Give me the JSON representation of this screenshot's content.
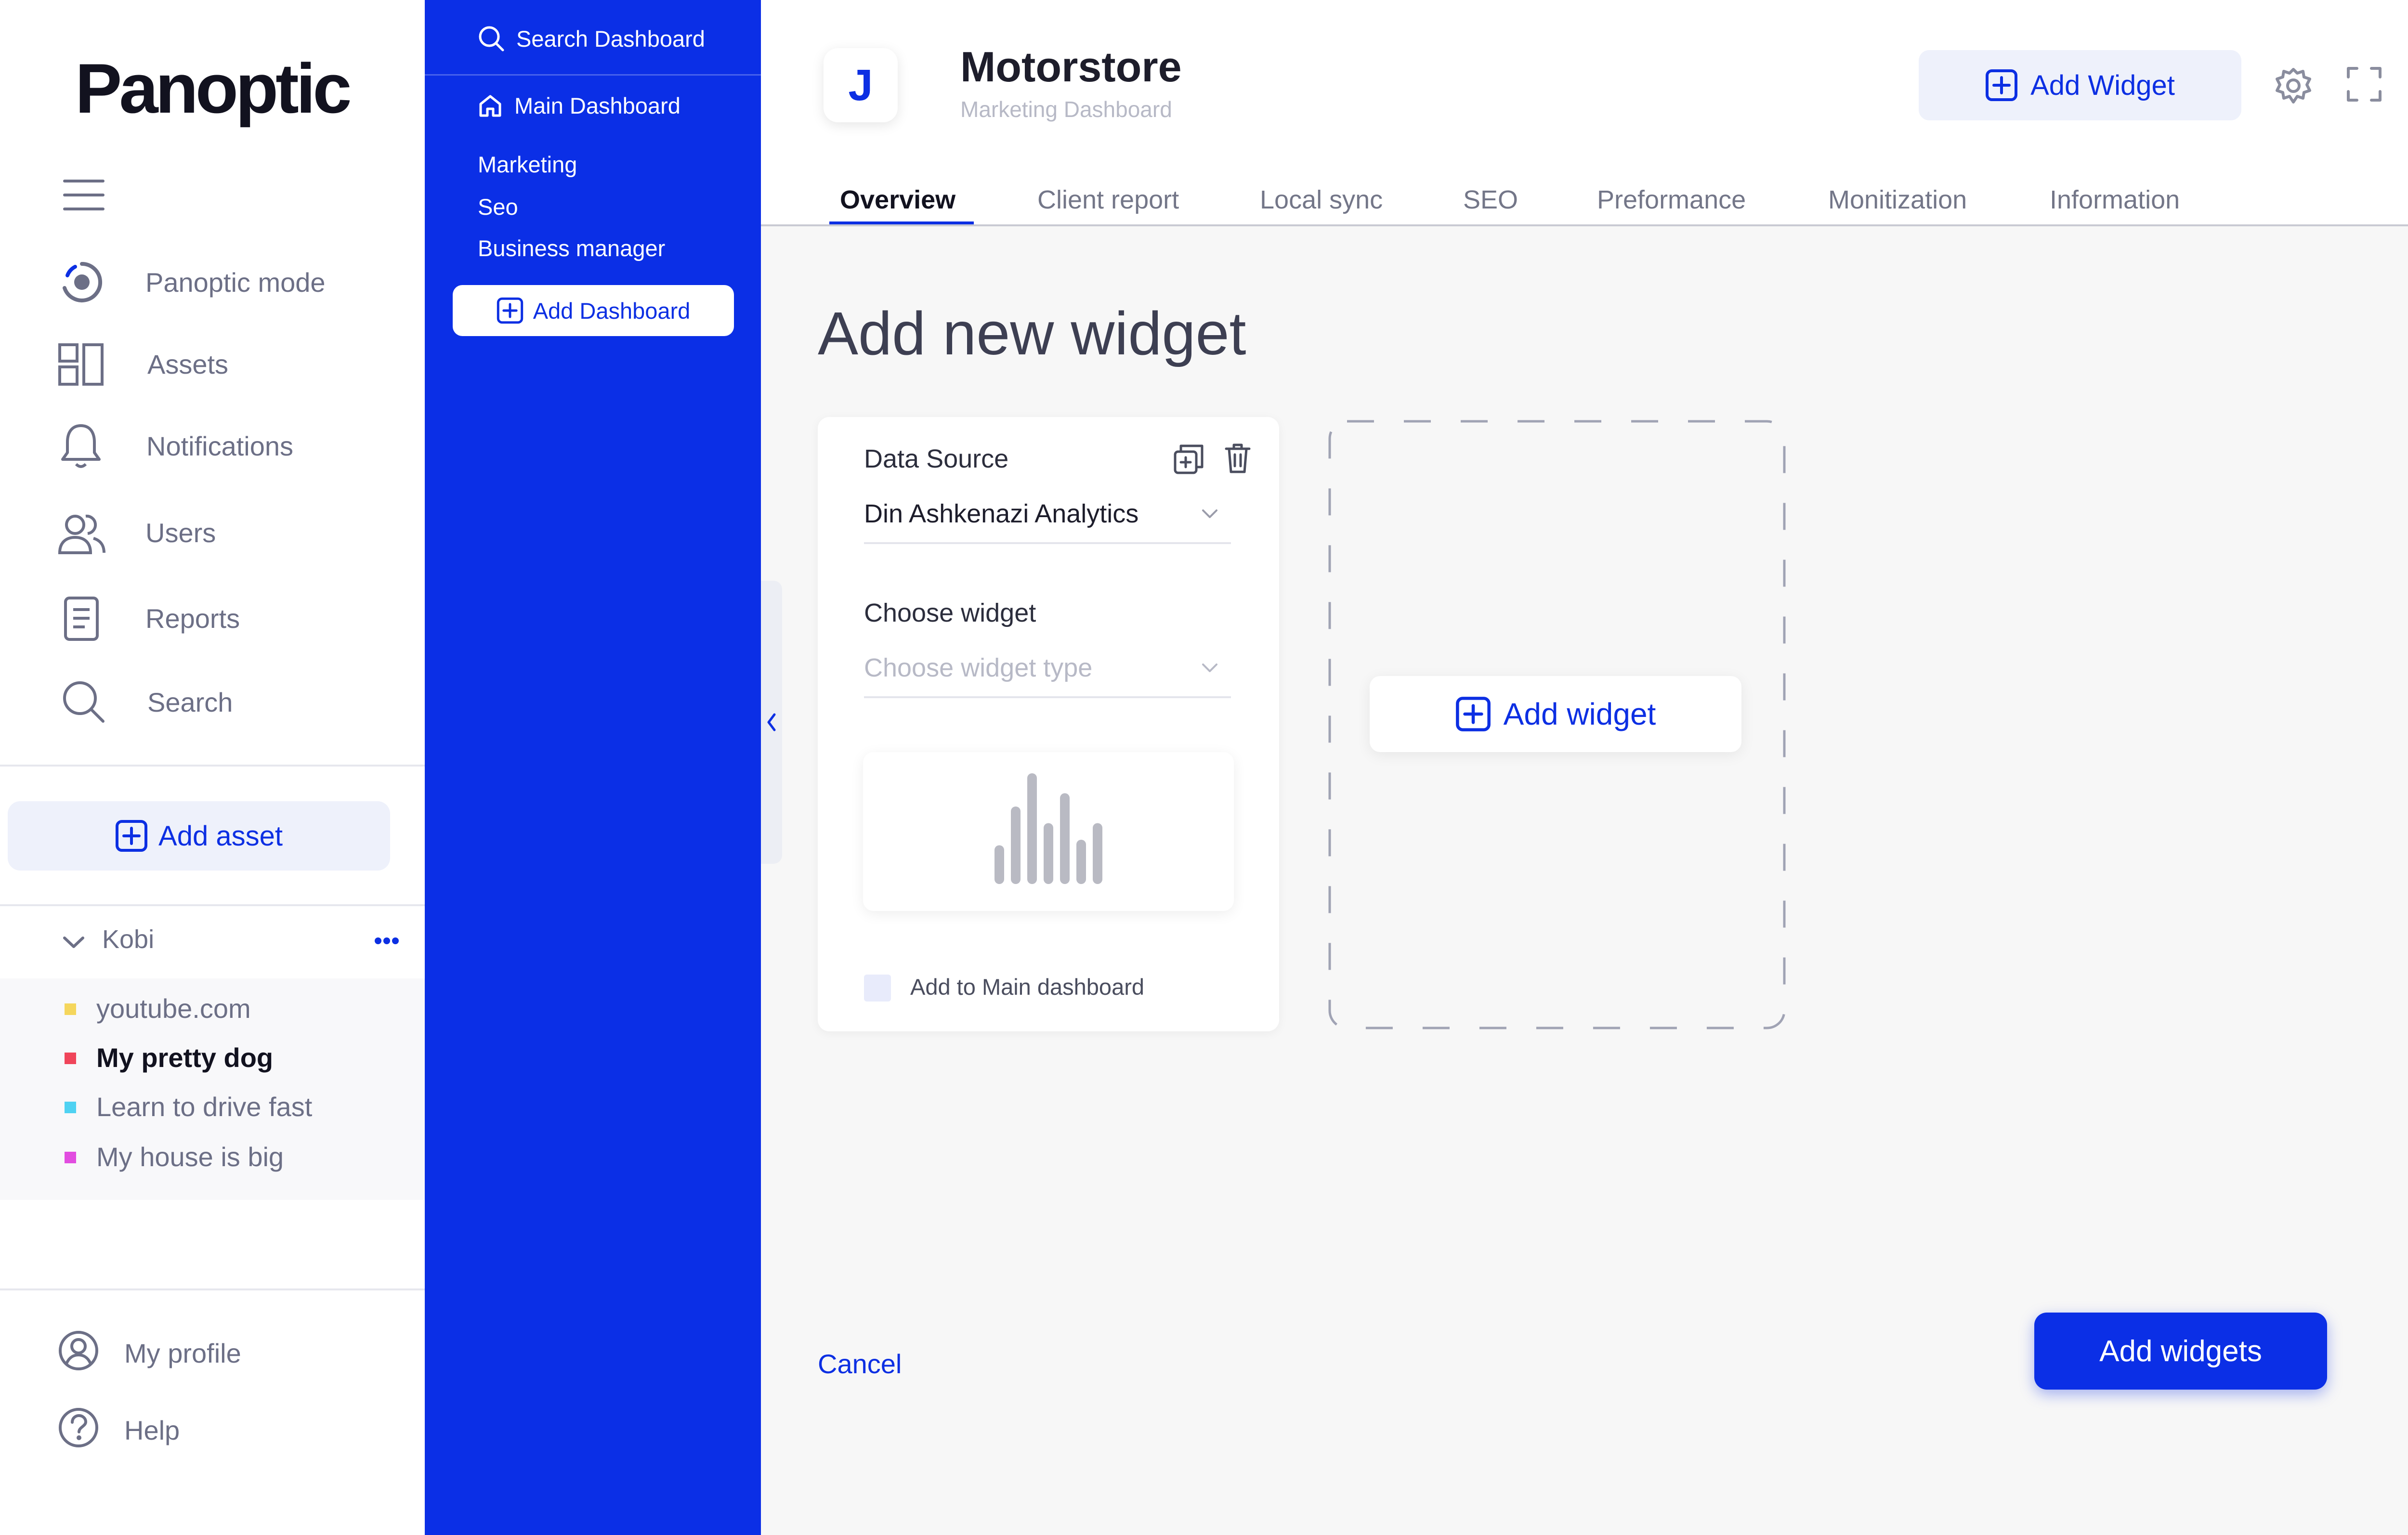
{
  "brand": {
    "logo_text": "Panoptic",
    "accent": "#0b2fe6"
  },
  "sidebar": {
    "menu_icon": "hamburger-icon",
    "nav": [
      {
        "label": "Panoptic mode",
        "icon": "panoptic-mode-icon"
      },
      {
        "label": "Assets",
        "icon": "assets-icon"
      },
      {
        "label": "Notifications",
        "icon": "bell-icon"
      },
      {
        "label": "Users",
        "icon": "users-icon"
      },
      {
        "label": "Reports",
        "icon": "reports-icon"
      },
      {
        "label": "Search",
        "icon": "search-icon"
      }
    ],
    "add_asset_label": "Add asset",
    "group": {
      "name": "Kobi",
      "items": [
        {
          "label": "youtube.com",
          "color": "#f5d65c"
        },
        {
          "label": "My pretty dog",
          "color": "#f0455a",
          "active": true
        },
        {
          "label": "Learn to drive fast",
          "color": "#4fd2f2"
        },
        {
          "label": "My house is big",
          "color": "#e24de0"
        }
      ]
    },
    "footer": [
      {
        "label": "My profile",
        "icon": "profile-icon"
      },
      {
        "label": "Help",
        "icon": "help-icon"
      }
    ]
  },
  "dashboard_panel": {
    "search_label": "Search Dashboard",
    "main_dashboard": "Main Dashboard",
    "items": [
      "Marketing",
      "Seo",
      "Business manager"
    ],
    "add_dashboard_label": "Add Dashboard"
  },
  "header": {
    "avatar_letter": "J",
    "title": "Motorstore",
    "subtitle": "Marketing Dashboard",
    "add_widget_label": "Add Widget",
    "tabs": [
      "Overview",
      "Client report",
      "Local sync",
      "SEO",
      "Preformance",
      "Monitization",
      "Information"
    ],
    "active_tab": "Overview"
  },
  "main": {
    "page_title": "Add new widget",
    "card": {
      "data_source_label": "Data Source",
      "data_source_value": "Din Ashkenazi Analytics",
      "choose_widget_label": "Choose widget",
      "choose_widget_placeholder": "Choose widget type",
      "preview_chart_data": {
        "type": "bar",
        "values": [
          0.35,
          0.7,
          1.0,
          0.55,
          0.82,
          0.4,
          0.55
        ]
      },
      "add_to_main_label": "Add to Main dashboard"
    },
    "add_widget_label": "Add widget",
    "cancel_label": "Cancel",
    "submit_label": "Add widgets"
  }
}
